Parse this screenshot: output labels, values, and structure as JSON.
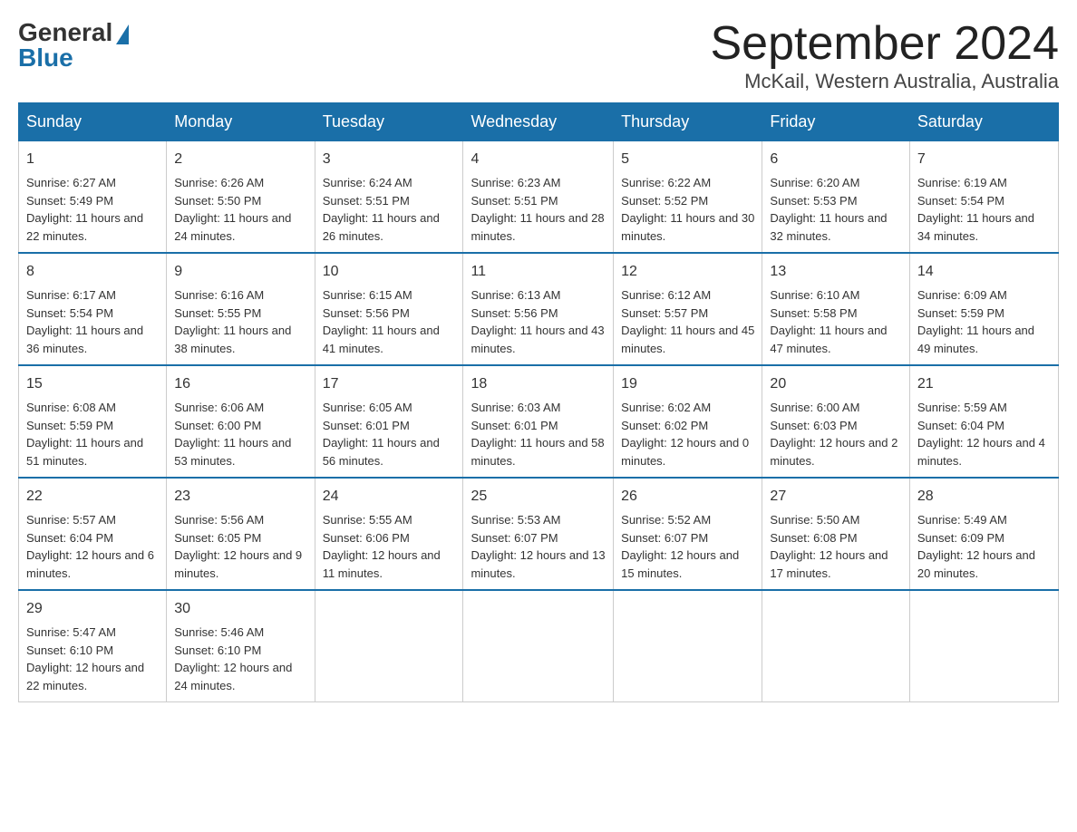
{
  "logo": {
    "general": "General",
    "blue": "Blue"
  },
  "header": {
    "title": "September 2024",
    "location": "McKail, Western Australia, Australia"
  },
  "days": [
    "Sunday",
    "Monday",
    "Tuesday",
    "Wednesday",
    "Thursday",
    "Friday",
    "Saturday"
  ],
  "weeks": [
    [
      {
        "num": "1",
        "sunrise": "6:27 AM",
        "sunset": "5:49 PM",
        "daylight": "11 hours and 22 minutes."
      },
      {
        "num": "2",
        "sunrise": "6:26 AM",
        "sunset": "5:50 PM",
        "daylight": "11 hours and 24 minutes."
      },
      {
        "num": "3",
        "sunrise": "6:24 AM",
        "sunset": "5:51 PM",
        "daylight": "11 hours and 26 minutes."
      },
      {
        "num": "4",
        "sunrise": "6:23 AM",
        "sunset": "5:51 PM",
        "daylight": "11 hours and 28 minutes."
      },
      {
        "num": "5",
        "sunrise": "6:22 AM",
        "sunset": "5:52 PM",
        "daylight": "11 hours and 30 minutes."
      },
      {
        "num": "6",
        "sunrise": "6:20 AM",
        "sunset": "5:53 PM",
        "daylight": "11 hours and 32 minutes."
      },
      {
        "num": "7",
        "sunrise": "6:19 AM",
        "sunset": "5:54 PM",
        "daylight": "11 hours and 34 minutes."
      }
    ],
    [
      {
        "num": "8",
        "sunrise": "6:17 AM",
        "sunset": "5:54 PM",
        "daylight": "11 hours and 36 minutes."
      },
      {
        "num": "9",
        "sunrise": "6:16 AM",
        "sunset": "5:55 PM",
        "daylight": "11 hours and 38 minutes."
      },
      {
        "num": "10",
        "sunrise": "6:15 AM",
        "sunset": "5:56 PM",
        "daylight": "11 hours and 41 minutes."
      },
      {
        "num": "11",
        "sunrise": "6:13 AM",
        "sunset": "5:56 PM",
        "daylight": "11 hours and 43 minutes."
      },
      {
        "num": "12",
        "sunrise": "6:12 AM",
        "sunset": "5:57 PM",
        "daylight": "11 hours and 45 minutes."
      },
      {
        "num": "13",
        "sunrise": "6:10 AM",
        "sunset": "5:58 PM",
        "daylight": "11 hours and 47 minutes."
      },
      {
        "num": "14",
        "sunrise": "6:09 AM",
        "sunset": "5:59 PM",
        "daylight": "11 hours and 49 minutes."
      }
    ],
    [
      {
        "num": "15",
        "sunrise": "6:08 AM",
        "sunset": "5:59 PM",
        "daylight": "11 hours and 51 minutes."
      },
      {
        "num": "16",
        "sunrise": "6:06 AM",
        "sunset": "6:00 PM",
        "daylight": "11 hours and 53 minutes."
      },
      {
        "num": "17",
        "sunrise": "6:05 AM",
        "sunset": "6:01 PM",
        "daylight": "11 hours and 56 minutes."
      },
      {
        "num": "18",
        "sunrise": "6:03 AM",
        "sunset": "6:01 PM",
        "daylight": "11 hours and 58 minutes."
      },
      {
        "num": "19",
        "sunrise": "6:02 AM",
        "sunset": "6:02 PM",
        "daylight": "12 hours and 0 minutes."
      },
      {
        "num": "20",
        "sunrise": "6:00 AM",
        "sunset": "6:03 PM",
        "daylight": "12 hours and 2 minutes."
      },
      {
        "num": "21",
        "sunrise": "5:59 AM",
        "sunset": "6:04 PM",
        "daylight": "12 hours and 4 minutes."
      }
    ],
    [
      {
        "num": "22",
        "sunrise": "5:57 AM",
        "sunset": "6:04 PM",
        "daylight": "12 hours and 6 minutes."
      },
      {
        "num": "23",
        "sunrise": "5:56 AM",
        "sunset": "6:05 PM",
        "daylight": "12 hours and 9 minutes."
      },
      {
        "num": "24",
        "sunrise": "5:55 AM",
        "sunset": "6:06 PM",
        "daylight": "12 hours and 11 minutes."
      },
      {
        "num": "25",
        "sunrise": "5:53 AM",
        "sunset": "6:07 PM",
        "daylight": "12 hours and 13 minutes."
      },
      {
        "num": "26",
        "sunrise": "5:52 AM",
        "sunset": "6:07 PM",
        "daylight": "12 hours and 15 minutes."
      },
      {
        "num": "27",
        "sunrise": "5:50 AM",
        "sunset": "6:08 PM",
        "daylight": "12 hours and 17 minutes."
      },
      {
        "num": "28",
        "sunrise": "5:49 AM",
        "sunset": "6:09 PM",
        "daylight": "12 hours and 20 minutes."
      }
    ],
    [
      {
        "num": "29",
        "sunrise": "5:47 AM",
        "sunset": "6:10 PM",
        "daylight": "12 hours and 22 minutes."
      },
      {
        "num": "30",
        "sunrise": "5:46 AM",
        "sunset": "6:10 PM",
        "daylight": "12 hours and 24 minutes."
      },
      null,
      null,
      null,
      null,
      null
    ]
  ]
}
